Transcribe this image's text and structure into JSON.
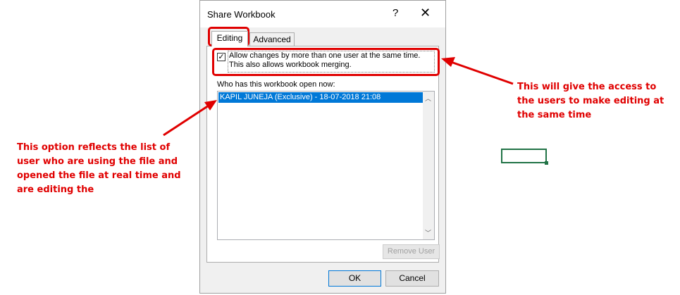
{
  "dialog": {
    "title": "Share Workbook",
    "help_glyph": "?",
    "close_glyph": "✕",
    "tabs": [
      {
        "label": "Editing",
        "selected": true
      },
      {
        "label": "Advanced",
        "selected": false
      }
    ],
    "allow_changes": {
      "checked": true,
      "check_glyph": "✓",
      "line1": "Allow changes by more than one user at the same time.",
      "line2": "This also allows workbook merging."
    },
    "who_label": "Who has this workbook open now:",
    "users": [
      "KAPIL JUNEJA (Exclusive) - 18-07-2018 21:08"
    ],
    "remove_user_label": "Remove User",
    "ok_label": "OK",
    "cancel_label": "Cancel"
  },
  "annotations": {
    "right_text": "This will give the access to the users to make editing at the same time",
    "left_text": "This option reflects the list of user who are using the file and opened the file at real time and are editing the",
    "color": "#e00000"
  },
  "colors": {
    "selection": "#0078d7",
    "cell_border": "#217346"
  }
}
